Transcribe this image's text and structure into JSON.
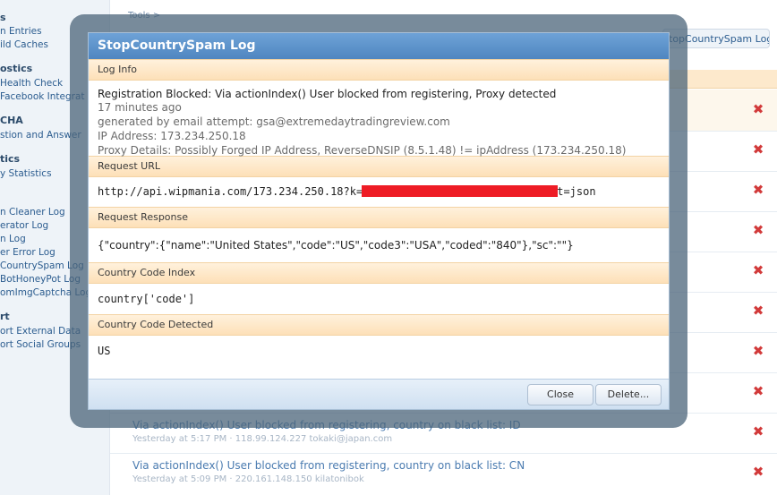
{
  "sidebar": {
    "items": [
      {
        "kind": "heading",
        "text": "s"
      },
      {
        "kind": "link",
        "text": "n Entries"
      },
      {
        "kind": "link",
        "text": "ild Caches"
      },
      {
        "kind": "heading",
        "text": "ostics"
      },
      {
        "kind": "link",
        "text": "Health Check"
      },
      {
        "kind": "link",
        "text": " Facebook Integrat"
      },
      {
        "kind": "heading",
        "text": "CHA"
      },
      {
        "kind": "link",
        "text": "stion and Answer"
      },
      {
        "kind": "heading",
        "text": "tics"
      },
      {
        "kind": "link",
        "text": "y Statistics"
      },
      {
        "kind": "link",
        "text": "n Cleaner Log"
      },
      {
        "kind": "link",
        "text": "erator Log"
      },
      {
        "kind": "link",
        "text": "n Log"
      },
      {
        "kind": "link",
        "text": "er Error Log"
      },
      {
        "kind": "link",
        "text": "CountrySpam Log"
      },
      {
        "kind": "link",
        "text": "BotHoneyPot Log"
      },
      {
        "kind": "link",
        "text": "omImgCaptcha Log"
      },
      {
        "kind": "heading",
        "text": "rt"
      },
      {
        "kind": "link",
        "text": "ort External Data"
      },
      {
        "kind": "link",
        "text": "ort Social Groups"
      }
    ]
  },
  "main": {
    "breadcrumb": "Tools >",
    "header_button": "topCountrySpam Log",
    "entries": [
      {
        "title": "Via actionIndex() User blocked from registering, country on black list: ID",
        "meta": "Yesterday at 5:17 PM · 118.99.124.227 tokaki@japan.com"
      },
      {
        "title": "Via actionIndex() User blocked from registering, country on black list: CN",
        "meta": "Yesterday at 5:09 PM · 220.161.148.150 kilatonibok"
      }
    ],
    "delete_icon": "close-x-icon"
  },
  "dialog": {
    "title": "StopCountrySpam Log",
    "log_info": {
      "header": "Log Info",
      "message": "Registration Blocked: Via actionIndex() User blocked from registering, Proxy detected",
      "time": "17 minutes ago",
      "email": "generated by email attempt: gsa@extremedaytradingreview.com",
      "ip": "IP Address: 173.234.250.18",
      "proxy": "Proxy Details: Possibly Forged IP Address, ReverseDNSIP (8.5.1.48) != ipAddress (173.234.250.18)"
    },
    "request_url": {
      "header": "Request URL",
      "prefix": "http://api.wipmania.com/173.234.250.18?k=",
      "suffix": "t=json"
    },
    "request_response": {
      "header": "Request Response",
      "body": "{\"country\":{\"name\":\"United States\",\"code\":\"US\",\"code3\":\"USA\",\"coded\":\"840\"},\"sc\":\"\"}"
    },
    "country_code_index": {
      "header": "Country Code Index",
      "value": "country['code']"
    },
    "country_code_detected": {
      "header": "Country Code Detected",
      "value": "US"
    },
    "buttons": {
      "close": "Close",
      "delete": "Delete..."
    }
  },
  "colors": {
    "title_bar": "#5b91c9",
    "section_header": "#fde0b8",
    "redaction": "#ee1c25",
    "delete_x": "#d23a3a"
  }
}
